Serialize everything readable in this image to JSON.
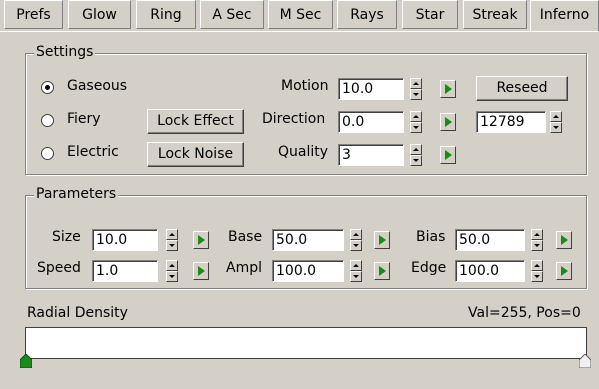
{
  "tabs": [
    "Prefs",
    "Glow",
    "Ring",
    "A Sec",
    "M Sec",
    "Rays",
    "Star",
    "Streak",
    "Inferno"
  ],
  "active_tab": "Inferno",
  "settings": {
    "title": "Settings",
    "radios": [
      {
        "label": "Gaseous",
        "selected": true
      },
      {
        "label": "Fiery",
        "selected": false
      },
      {
        "label": "Electric",
        "selected": false
      }
    ],
    "lock_effect": "Lock Effect",
    "lock_noise": "Lock Noise",
    "motion_label": "Motion",
    "motion_value": "10.0",
    "direction_label": "Direction",
    "direction_value": "0.0",
    "quality_label": "Quality",
    "quality_value": "3",
    "reseed": "Reseed",
    "seed_value": "12789"
  },
  "parameters": {
    "title": "Parameters",
    "size_label": "Size",
    "size_value": "10.0",
    "speed_label": "Speed",
    "speed_value": "1.0",
    "base_label": "Base",
    "base_value": "50.0",
    "ampl_label": "Ampl",
    "ampl_value": "100.0",
    "bias_label": "Bias",
    "bias_value": "50.0",
    "edge_label": "Edge",
    "edge_value": "100.0"
  },
  "radial": {
    "label": "Radial Density",
    "readout": "Val=255, Pos=0"
  },
  "colors": {
    "panel": "#d4d0c8",
    "key_arrow": "#1a8a1a",
    "start_flag": "#1a8a1a"
  }
}
